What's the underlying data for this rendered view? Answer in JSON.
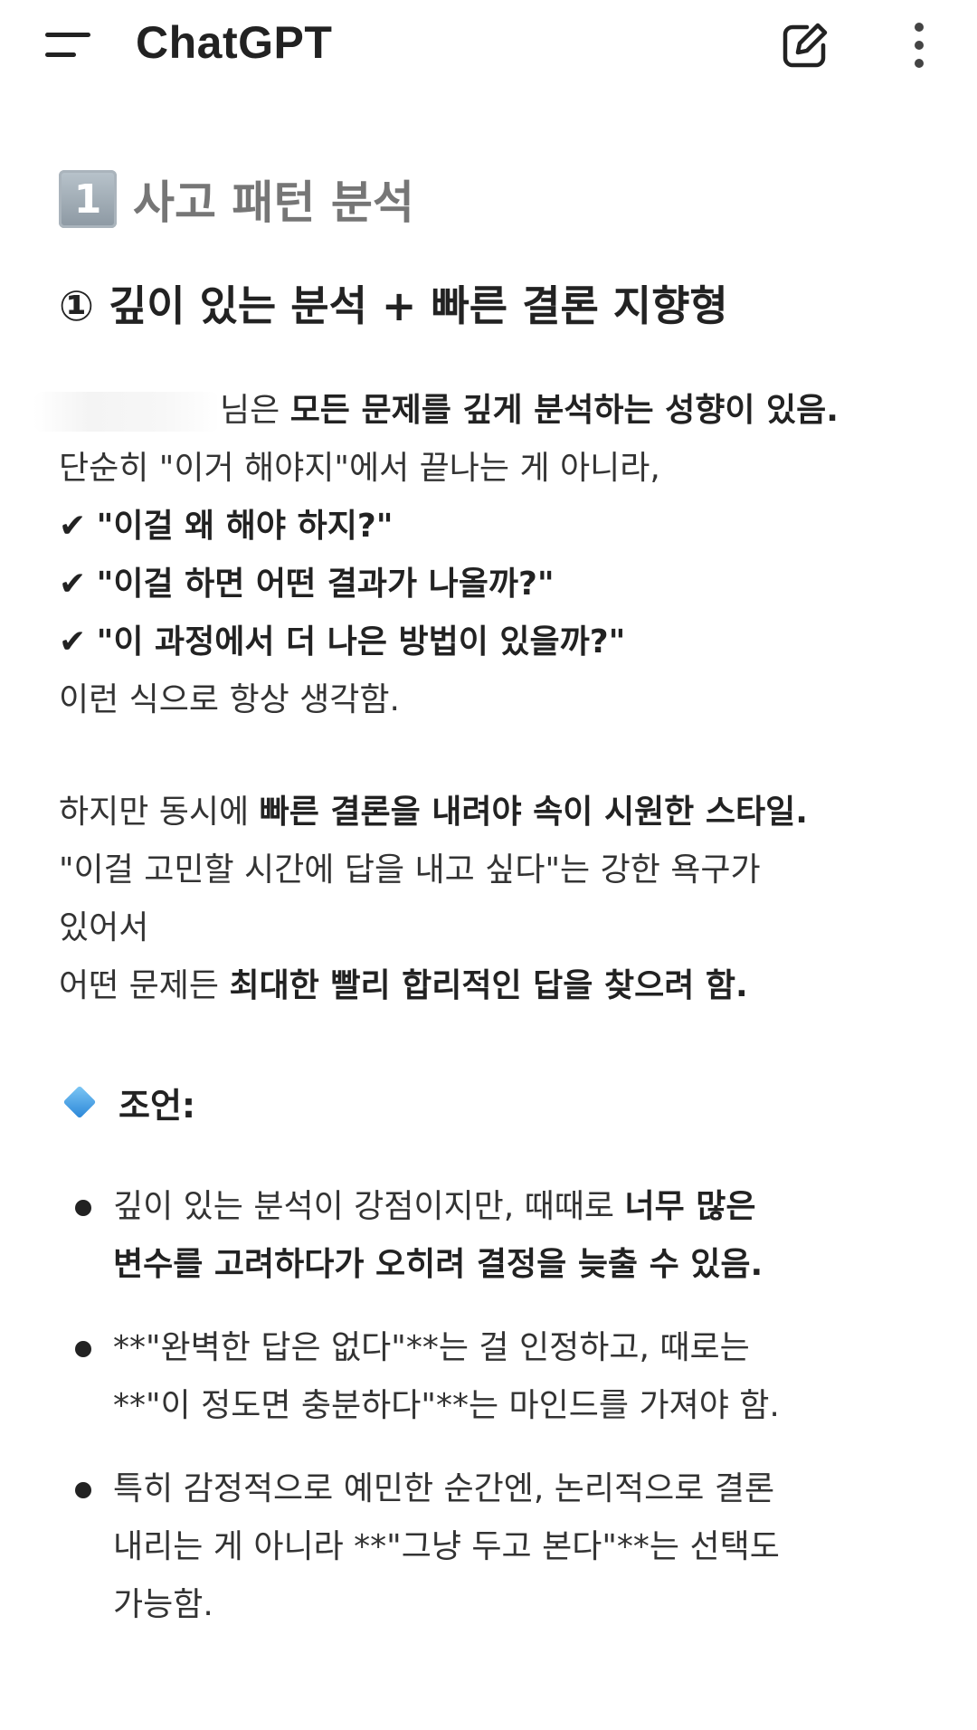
{
  "header": {
    "app_title": "ChatGPT"
  },
  "icons": {
    "menu": "menu-icon",
    "new_chat": "new-chat-icon",
    "more": "more-vertical-icon",
    "keycap": "keycap-1-icon",
    "check": "check-mark-icon",
    "diamond": "blue-diamond-icon",
    "bullet": "bullet-icon"
  },
  "message": {
    "section_number": "1",
    "section_title": "사고 패턴 분석",
    "subheading": "① 깊이 있는 분석 + 빠른 결론 지향형",
    "p1_a": "님은 ",
    "p1_b": "모든 문제를 깊게 분석하는 성향이 있음.",
    "p1_line2": "단순히 \"이거 해야지\"에서 끝나는 게 아니라,",
    "check_mark": "✔",
    "check1": "\"이걸 왜 해야 하지?\"",
    "check2": "\"이걸 하면 어떤 결과가 나올까?\"",
    "check3": "\"이 과정에서 더 나은 방법이 있을까?\"",
    "p1_end": "이런 식으로 항상 생각함.",
    "p2_a": "하지만 동시에 ",
    "p2_b": "빠른 결론을 내려야 속이 시원한 스타일.",
    "p2_line2": "\"이걸 고민할 시간에 답을 내고 싶다\"는 강한 욕구가",
    "p2_line3": "있어서",
    "p2_line4_a": "어떤 문제든 ",
    "p2_line4_b": "최대한 빨리 합리적인 답을 찾으려 함.",
    "advice_label": "조언:",
    "bullet1_a": "깊이 있는 분석이 강점이지만, 때때로 ",
    "bullet1_b": "너무 많은",
    "bullet1_c": "변수를 고려하다가 오히려 결정을 늦출 수 있음.",
    "bullet2_line1": "**\"완벽한 답은 없다\"**는 걸 인정하고, 때로는",
    "bullet2_line2": "**\"이 정도면 충분하다\"**는 마인드를 가져야 함.",
    "bullet3_line1": "특히 감정적으로 예민한 순간엔, 논리적으로 결론",
    "bullet3_line2": "내리는 게 아니라 **\"그냥 두고 본다\"**는 선택도",
    "bullet3_line3": "가능함."
  }
}
